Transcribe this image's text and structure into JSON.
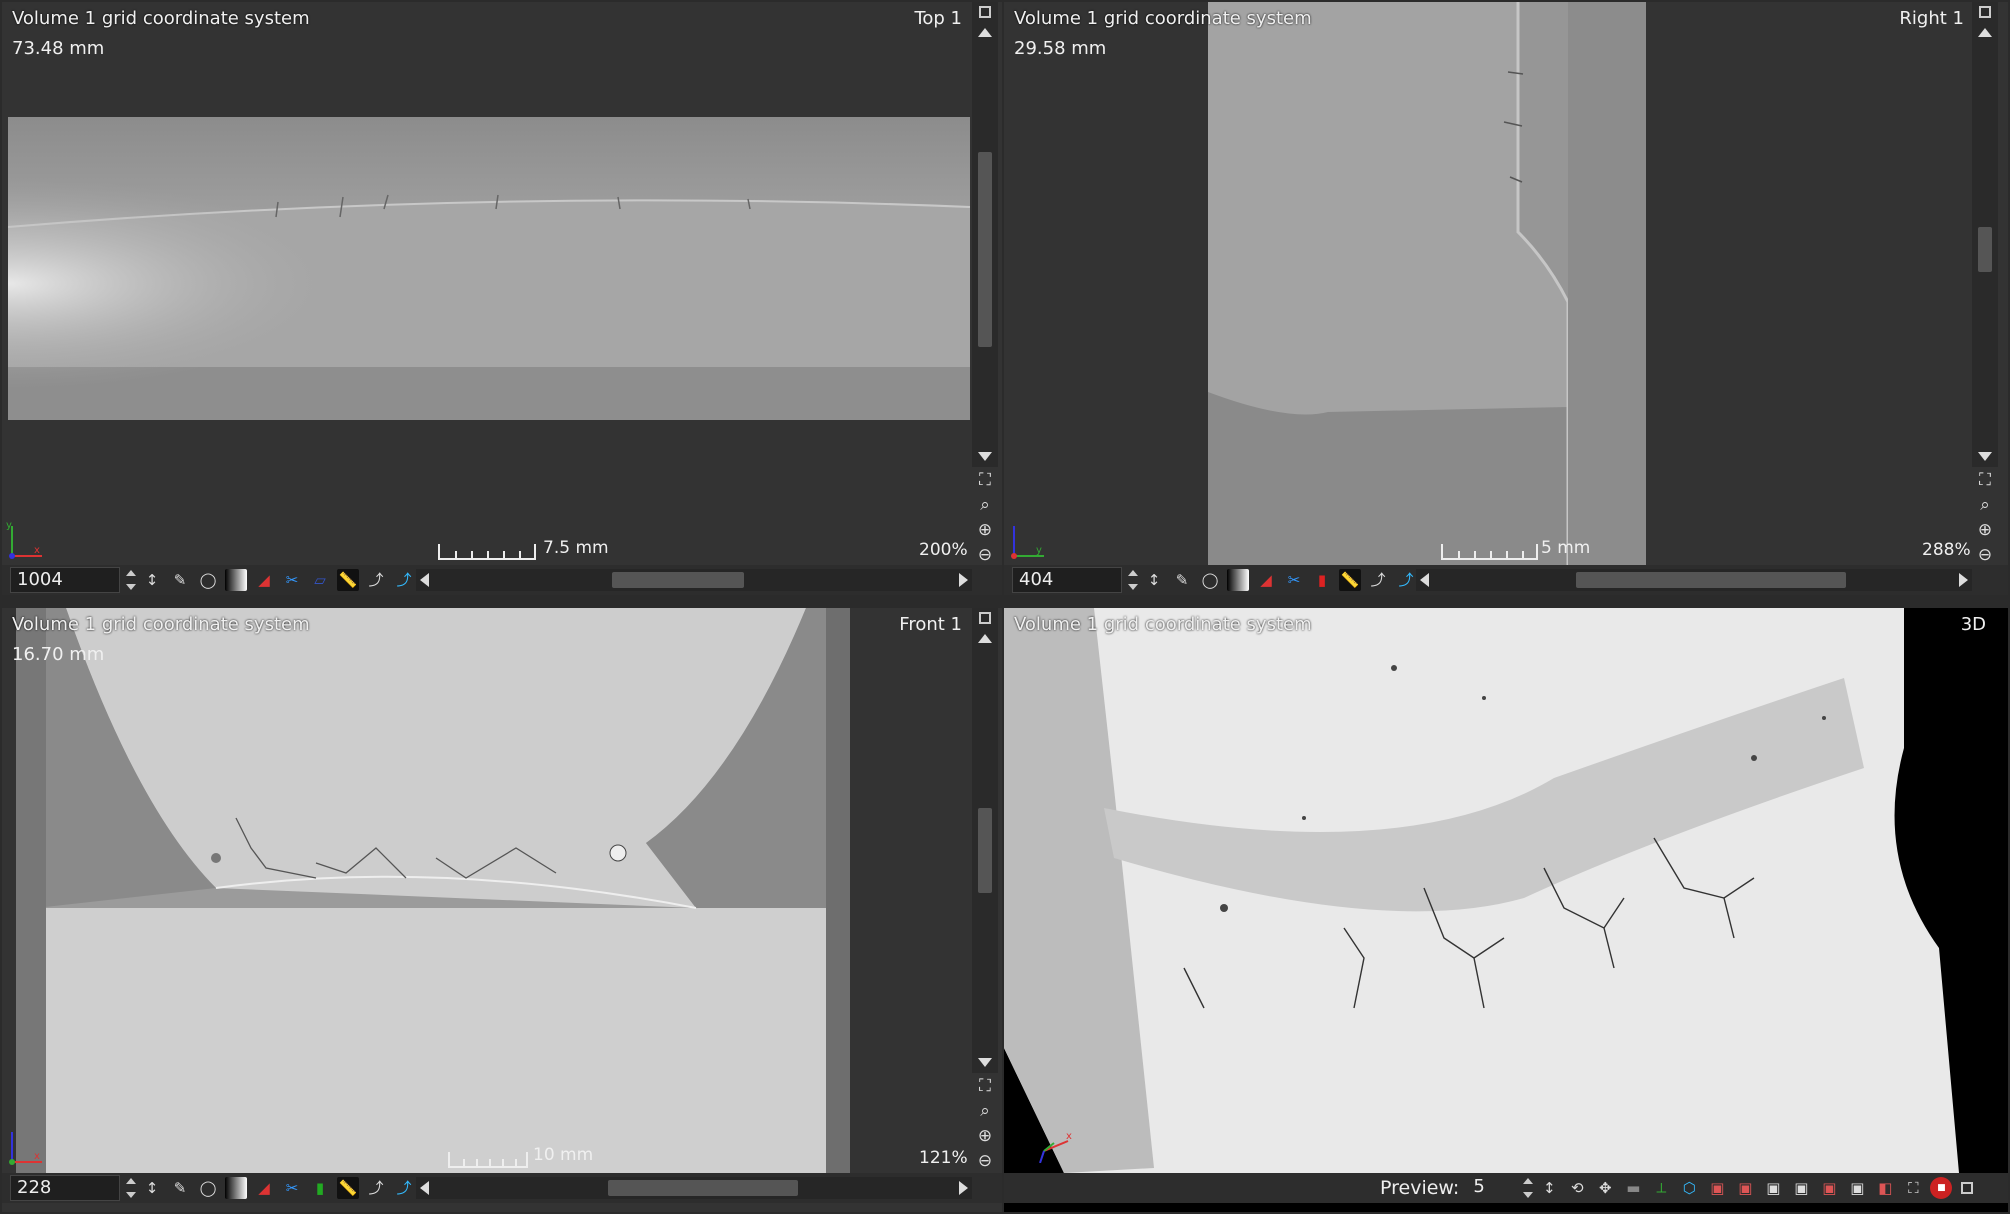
{
  "views": {
    "top": {
      "title": "Volume 1 grid coordinate system",
      "dimension": "73.48 mm",
      "name": "Top 1",
      "zoom": "200%",
      "scale_label": "7.5 mm",
      "slice": "1004"
    },
    "right": {
      "title": "Volume 1 grid coordinate system",
      "dimension": "29.58 mm",
      "name": "Right 1",
      "zoom": "288%",
      "scale_label": "5 mm",
      "slice": "404"
    },
    "front": {
      "title": "Volume 1 grid coordinate system",
      "dimension": "16.70 mm",
      "name": "Front 1",
      "zoom": "121%",
      "scale_label": "10 mm",
      "slice": "228"
    },
    "three_d": {
      "title": "Volume 1 grid coordinate system",
      "name": "3D",
      "preview_label": "Preview:",
      "preview_value": "5"
    }
  },
  "axes": {
    "x": "x",
    "y": "y"
  },
  "colors": {
    "panel_bg": "#333333",
    "border": "#2b2b2b",
    "axis_x": "#d33",
    "axis_y": "#3a3",
    "axis_z": "#33d"
  }
}
